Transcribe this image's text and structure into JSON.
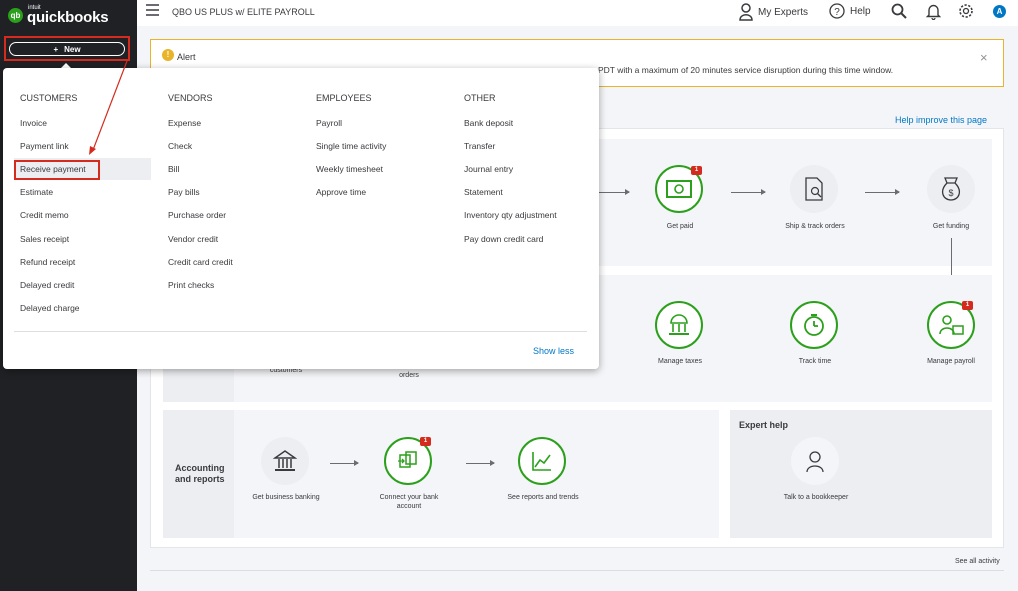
{
  "brand": {
    "intuit": "intuit",
    "name": "quickbooks",
    "mark": "qb"
  },
  "new_button": {
    "plus": "+",
    "label": "New"
  },
  "header": {
    "company": "QBO US PLUS w/ ELITE PAYROLL",
    "my_experts": "My Experts",
    "help": "Help",
    "avatar_initial": "A"
  },
  "alert": {
    "title": "Alert",
    "text_visible": "PDT with a maximum of 20 minutes service disruption during this time window.",
    "close": "×"
  },
  "help_improve": "Help improve this page",
  "flow": {
    "get_paid": "Get paid",
    "ship_track": "Ship & track orders",
    "get_funding": "Get funding",
    "customers_partial": "customers",
    "orders_partial": "orders",
    "manage_taxes": "Manage taxes",
    "track_time": "Track time",
    "manage_payroll": "Manage payroll",
    "accounting_reports": "Accounting and reports",
    "get_business_banking": "Get business banking",
    "connect_bank": "Connect your bank account",
    "see_reports": "See reports and trends",
    "expert_help": "Expert help",
    "talk_bookkeeper": "Talk to a bookkeeper",
    "badge": "1"
  },
  "see_all_activity": "See all activity",
  "menu": {
    "columns": [
      {
        "heading": "CUSTOMERS",
        "items": [
          "Invoice",
          "Payment link",
          "Receive payment",
          "Estimate",
          "Credit memo",
          "Sales receipt",
          "Refund receipt",
          "Delayed credit",
          "Delayed charge"
        ]
      },
      {
        "heading": "VENDORS",
        "items": [
          "Expense",
          "Check",
          "Bill",
          "Pay bills",
          "Purchase order",
          "Vendor credit",
          "Credit card credit",
          "Print checks"
        ]
      },
      {
        "heading": "EMPLOYEES",
        "items": [
          "Payroll",
          "Single time activity",
          "Weekly timesheet",
          "Approve time"
        ]
      },
      {
        "heading": "OTHER",
        "items": [
          "Bank deposit",
          "Transfer",
          "Journal entry",
          "Statement",
          "Inventory qty adjustment",
          "Pay down credit card"
        ]
      }
    ],
    "show_less": "Show less"
  },
  "colors": {
    "accent_green": "#2ca01c",
    "highlight_red": "#d52b1e",
    "link_blue": "#0077c5",
    "sidebar": "#1f2124"
  }
}
